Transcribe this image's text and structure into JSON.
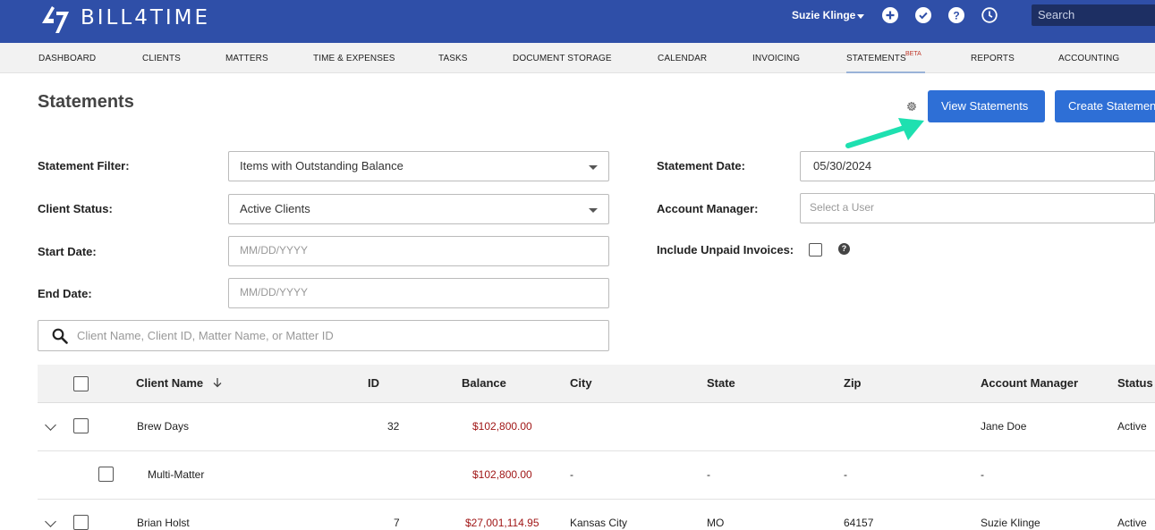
{
  "header": {
    "logo_text": "BILL4TIME",
    "user_name": "Suzie Klinge",
    "search_placeholder": "Search",
    "icons": [
      "plus-circle-icon",
      "check-circle-icon",
      "question-circle-icon",
      "clock-icon"
    ]
  },
  "nav": {
    "items": [
      "DASHBOARD",
      "CLIENTS",
      "MATTERS",
      "TIME & EXPENSES",
      "TASKS",
      "DOCUMENT STORAGE",
      "CALENDAR",
      "INVOICING",
      "STATEMENTS",
      "REPORTS",
      "ACCOUNTING"
    ],
    "active": "STATEMENTS",
    "statements_badge": "BETA"
  },
  "page": {
    "title": "Statements",
    "view_button": "View Statements",
    "create_button": "Create Statements"
  },
  "form": {
    "statement_filter_label": "Statement Filter:",
    "statement_filter_value": "Items with Outstanding Balance",
    "client_status_label": "Client Status:",
    "client_status_value": "Active Clients",
    "start_date_label": "Start Date:",
    "start_date_placeholder": "MM/DD/YYYY",
    "end_date_label": "End Date:",
    "end_date_placeholder": "MM/DD/YYYY",
    "statement_date_label": "Statement Date:",
    "statement_date_value": "05/30/2024",
    "account_manager_label": "Account Manager:",
    "account_manager_placeholder": "Select a User",
    "include_unpaid_label": "Include Unpaid Invoices:",
    "search_placeholder": "Client Name, Client ID, Matter Name, or Matter ID"
  },
  "table": {
    "columns": [
      "Client Name",
      "ID",
      "Balance",
      "City",
      "State",
      "Zip",
      "Account Manager",
      "Status"
    ],
    "rows": [
      {
        "client": "Brew Days",
        "id": "32",
        "balance": "$102,800.00",
        "city": "",
        "state": "",
        "zip": "",
        "manager": "Jane Doe",
        "status": "Active"
      },
      {
        "client": "Multi-Matter",
        "id": "",
        "balance": "$102,800.00",
        "city": "-",
        "state": "-",
        "zip": "-",
        "manager": "-",
        "status": ""
      },
      {
        "client": "Brian Holst",
        "id": "7",
        "balance": "$27,001,114.95",
        "city": "Kansas City",
        "state": "MO",
        "zip": "64157",
        "manager": "Suzie Klinge",
        "status": "Active"
      }
    ]
  },
  "colors": {
    "topbar": "#2f4fa8",
    "primary_button": "#2e6fd6",
    "annotation_arrow": "#1ee0b0",
    "money": "#a01717"
  }
}
